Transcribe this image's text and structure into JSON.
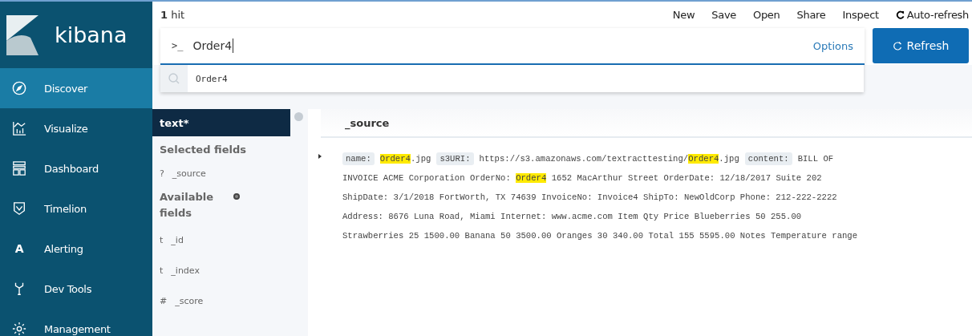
{
  "logo": {
    "text": "kibana"
  },
  "nav": [
    {
      "label": "Discover",
      "selected": true
    },
    {
      "label": "Visualize",
      "selected": false
    },
    {
      "label": "Dashboard",
      "selected": false
    },
    {
      "label": "Timelion",
      "selected": false
    },
    {
      "label": "Alerting",
      "glyph": "A",
      "selected": false
    },
    {
      "label": "Dev Tools",
      "selected": false
    },
    {
      "label": "Management",
      "selected": false
    }
  ],
  "hits": {
    "count": "1",
    "label": "hit"
  },
  "top_menu": [
    "New",
    "Save",
    "Open",
    "Share",
    "Inspect"
  ],
  "auto_refresh": {
    "label": "Auto-refresh"
  },
  "search": {
    "prompt": ">_",
    "value": "Order4",
    "options": "Options"
  },
  "refresh_button": {
    "label": "Refresh"
  },
  "suggestions": [
    "Order4"
  ],
  "index_pattern": {
    "label": "text*"
  },
  "selected_fields": {
    "heading": "Selected fields",
    "items": [
      {
        "type": "?",
        "name": "_source"
      }
    ]
  },
  "available_fields": {
    "heading": "Available fields",
    "items": [
      {
        "type": "t",
        "name": "_id"
      },
      {
        "type": "t",
        "name": "_index"
      },
      {
        "type": "#",
        "name": "_score"
      }
    ]
  },
  "document_table": {
    "column": "_source",
    "rows": [
      {
        "expanded": false,
        "lines": [
          [
            {
              "kind": "key",
              "text": "name:"
            },
            {
              "kind": "match",
              "text": "Order4"
            },
            {
              "kind": "text",
              "text": ".jpg"
            },
            {
              "kind": "key",
              "text": "s3URI:"
            },
            {
              "kind": "text",
              "text": "https://s3.amazonaws.com/textracttesting/"
            },
            {
              "kind": "match",
              "text": "Order4"
            },
            {
              "kind": "text",
              "text": ".jpg"
            },
            {
              "kind": "key",
              "text": "content:"
            },
            {
              "kind": "text",
              "text": "BILL OF"
            }
          ],
          [
            {
              "kind": "text",
              "text": "INVOICE ACME Corporation OrderNo: "
            },
            {
              "kind": "match",
              "text": "Order4"
            },
            {
              "kind": "text",
              "text": " 1652 MacArthur Street OrderDate: 12/18/2017 Suite 202"
            }
          ],
          [
            {
              "kind": "text",
              "text": "ShipDate: 3/1/2018 FortWorth, TX 74639 InvoiceNo: Invoice4 ShipTo: NewOldCorp Phone: 212-222-2222"
            }
          ],
          [
            {
              "kind": "text",
              "text": "Address: 8676 Luna Road, Miami Internet: www.acme.com Item Qty Price Blueberries 50 255.00"
            }
          ],
          [
            {
              "kind": "text",
              "text": "Strawberries 25 1500.00 Banana 50 3500.00 Oranges 30 340.00 Total 155 5595.00 Notes Temperature range"
            }
          ]
        ]
      }
    ]
  }
}
